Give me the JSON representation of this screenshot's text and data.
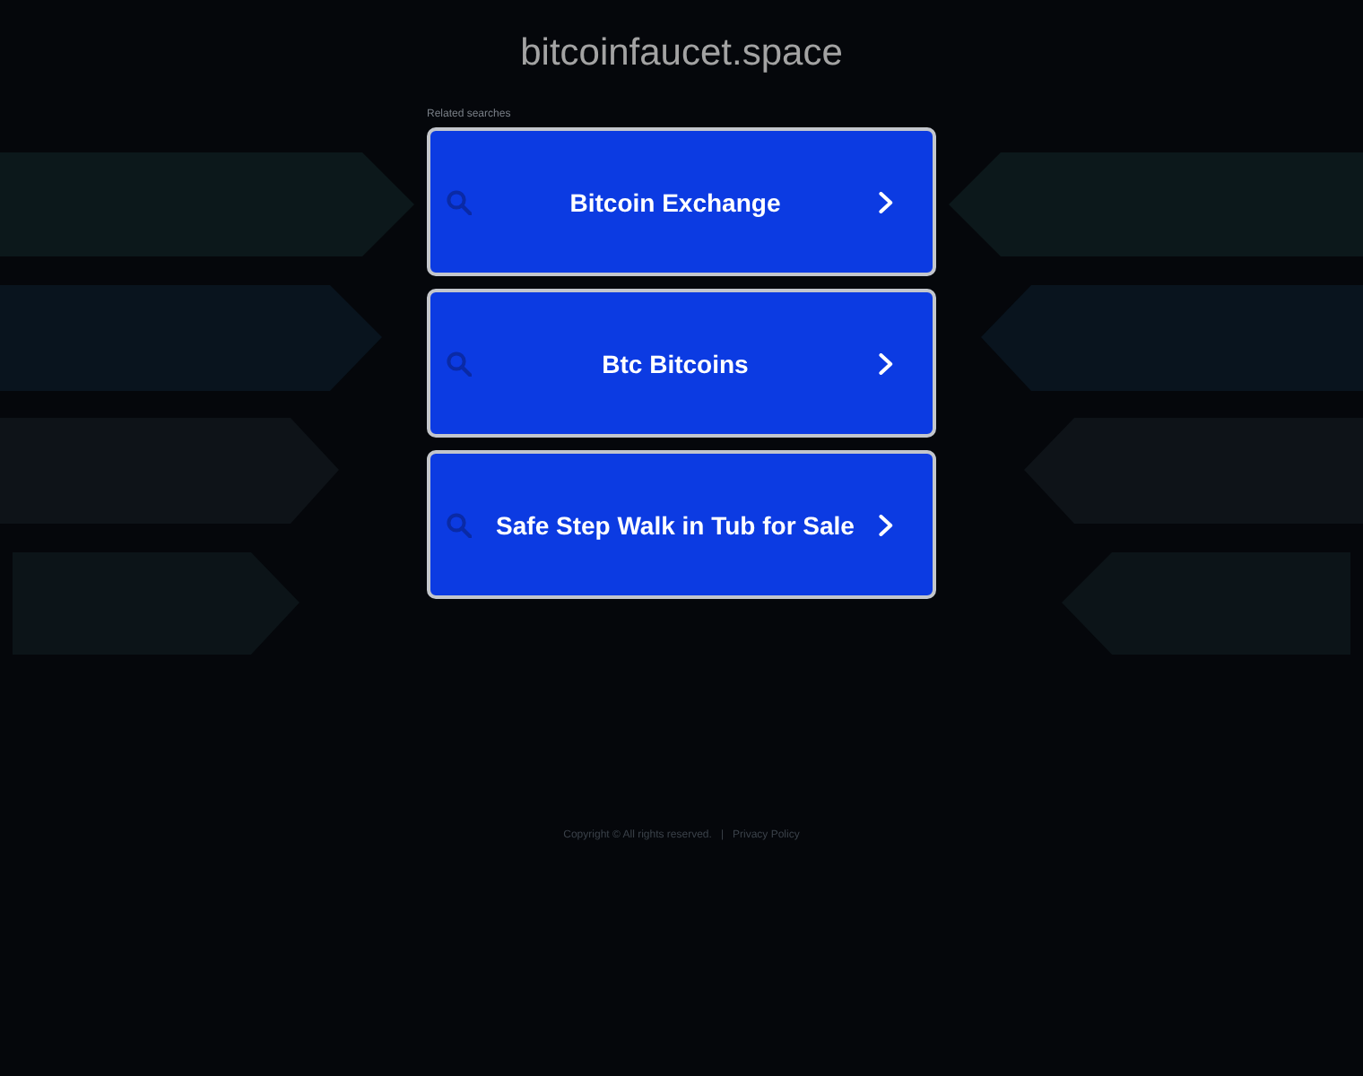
{
  "header": {
    "domain": "bitcoinfaucet.space"
  },
  "related_searches": {
    "label": "Related searches",
    "items": [
      {
        "label": "Bitcoin Exchange"
      },
      {
        "label": "Btc Bitcoins"
      },
      {
        "label": "Safe Step Walk in Tub for Sale"
      }
    ]
  },
  "footer": {
    "copyright": "Copyright © All rights reserved.",
    "separator": "|",
    "privacy_link": "Privacy Policy"
  }
}
